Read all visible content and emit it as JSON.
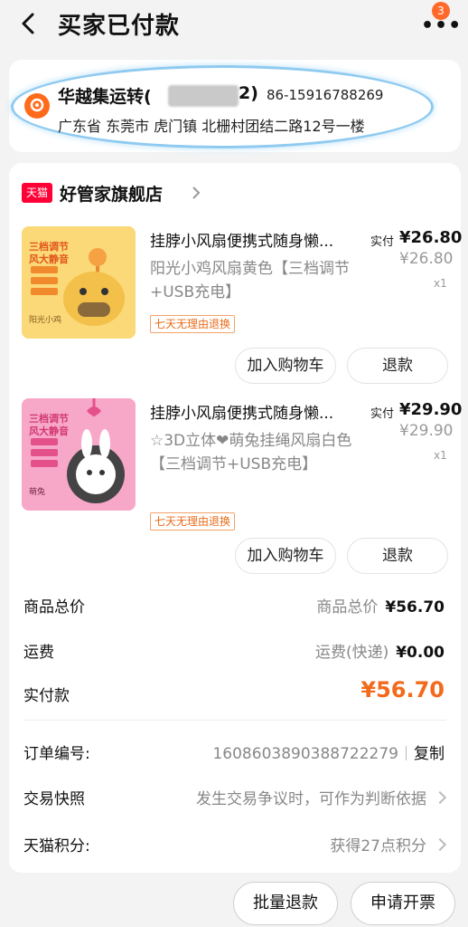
{
  "header": {
    "title": "买家已付款",
    "badge_count": "3"
  },
  "address": {
    "name_prefix": "华越集运转(",
    "name_suffix": "2)",
    "phone": "86-15916788269",
    "full_address": "广东省 东莞市 虎门镇 北栅村团结二路12号一楼"
  },
  "shop": {
    "platform_logo": "天猫",
    "name": "好管家旗舰店"
  },
  "items": [
    {
      "title": "挂脖小风扇便携式随身懒...",
      "spec": "阳光小鸡风扇黄色【三档调节+USB充电】",
      "guarantee": "七天无理由退换",
      "paid_label": "实付",
      "paid_price": "¥26.80",
      "orig_price": "¥26.80",
      "quantity": "x1",
      "add_cart": "加入购物车",
      "refund": "退款",
      "thumb_text_1": "三档调节",
      "thumb_text_2": "风大静音",
      "thumb_caption": "阳光小鸡",
      "thumb_color": "#fbd978"
    },
    {
      "title": "挂脖小风扇便携式随身懒...",
      "spec": "☆3D立体❤萌兔挂绳风扇白色【三档调节+USB充电】",
      "guarantee": "七天无理由退换",
      "paid_label": "实付",
      "paid_price": "¥29.90",
      "orig_price": "¥29.90",
      "quantity": "x1",
      "add_cart": "加入购物车",
      "refund": "退款",
      "thumb_text_1": "三档调节",
      "thumb_text_2": "风大静音",
      "thumb_caption": "萌兔",
      "thumb_color": "#f7a8c8"
    }
  ],
  "summary": {
    "goods_total_label": "商品总价",
    "goods_total_sub": "商品总价",
    "goods_total_value": "¥56.70",
    "shipping_label": "运费",
    "shipping_sub": "运费(快递)",
    "shipping_value": "¥0.00",
    "paid_label": "实付款",
    "paid_value": "¥56.70"
  },
  "order_info": {
    "order_no_label": "订单编号:",
    "order_no": "1608603890388722279",
    "copy": "复制",
    "snapshot_label": "交易快照",
    "snapshot_value": "发生交易争议时，可作为判断依据",
    "points_label": "天猫积分:",
    "points_value": "获得27点积分"
  },
  "bottom": {
    "batch_refund": "批量退款",
    "invoice": "申请开票"
  },
  "colors": {
    "accent": "#f26a1b",
    "tmall_red": "#ff0036"
  }
}
